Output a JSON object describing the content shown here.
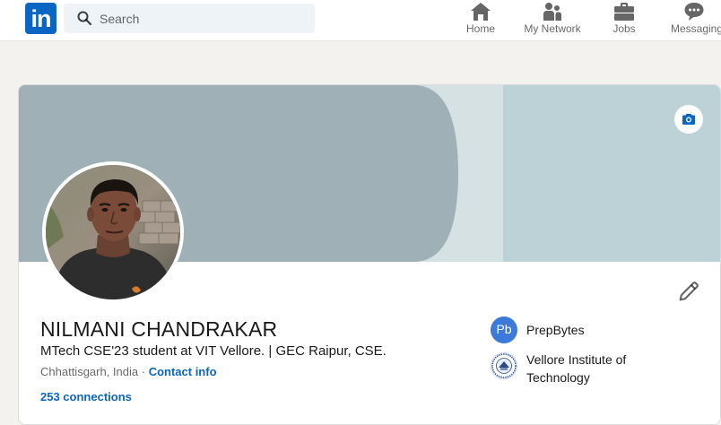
{
  "nav": {
    "logo_text": "in",
    "search_placeholder": "Search",
    "items": [
      {
        "label": "Home",
        "icon": "home-icon"
      },
      {
        "label": "My Network",
        "icon": "network-icon"
      },
      {
        "label": "Jobs",
        "icon": "briefcase-icon"
      },
      {
        "label": "Messaging",
        "icon": "chat-icon"
      }
    ]
  },
  "profile": {
    "name": "NILMANI CHANDRAKAR",
    "headline": "MTech CSE'23 student at VIT Vellore. | GEC Raipur, CSE.",
    "location": "Chhattisgarh, India",
    "separator": " · ",
    "contact_label": "Contact info",
    "connections": "253 connections"
  },
  "organizations": [
    {
      "name": "PrepBytes",
      "logo_text": "Pb",
      "icon": "prepbytes-logo"
    },
    {
      "name": "Vellore Institute of Technology",
      "logo_text": "VIT",
      "icon": "vit-logo"
    }
  ],
  "colors": {
    "brand": "#0a66c2",
    "banner_dark": "#9fb1b6",
    "banner_light": "#bdd2d6",
    "banner_band": "#d6e1e4",
    "page_bg": "#f3f2ef"
  }
}
